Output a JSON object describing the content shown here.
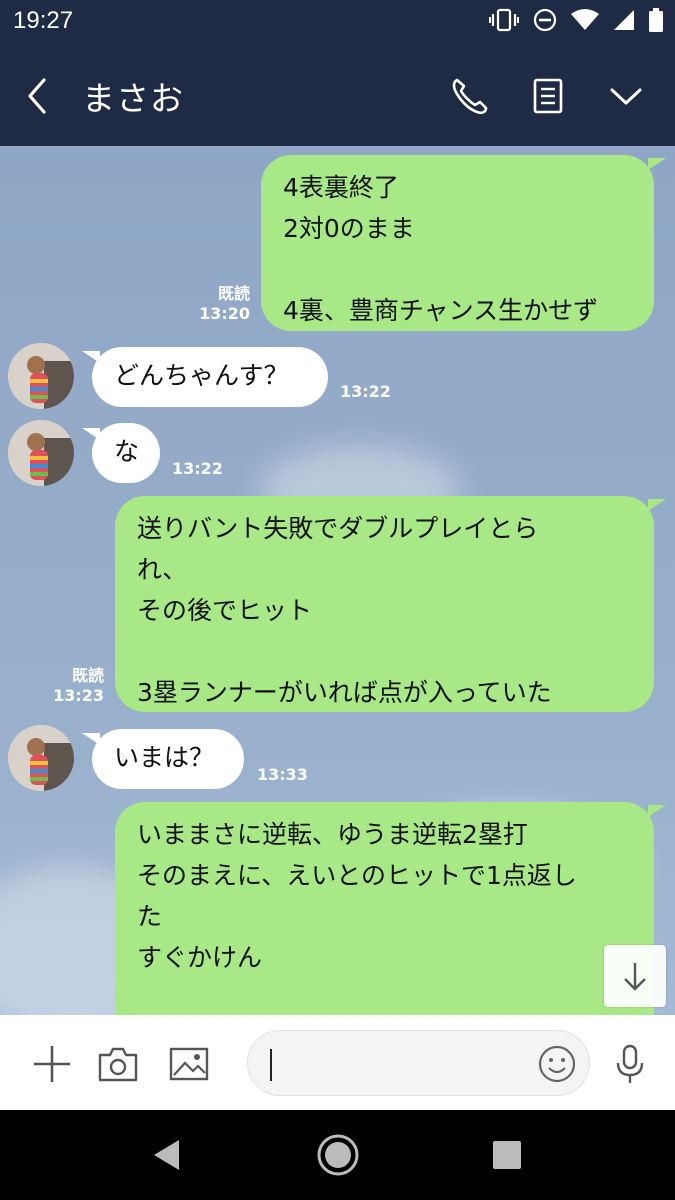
{
  "status_bar": {
    "time": "19:27"
  },
  "header": {
    "title": "まさお"
  },
  "messages": [
    {
      "from": "me",
      "text": "4表裏終了\n2対0のまま\n\n4裏、豊商チャンス生かせず",
      "read": "既読",
      "time": "13:20"
    },
    {
      "from": "them",
      "text": "どんちゃんす？",
      "time": "13:22"
    },
    {
      "from": "them",
      "text": "な",
      "time": "13:22"
    },
    {
      "from": "me",
      "text": "送りバント失敗でダブルプレイとら\nれ、\nその後でヒット\n\n3塁ランナーがいれば点が入っていた",
      "read": "既読",
      "time": "13:23"
    },
    {
      "from": "them",
      "text": "いまは？",
      "time": "13:33"
    },
    {
      "from": "me",
      "text": "いままさに逆転、ゆうま逆転2塁打\nそのまえに、えいとのヒットで1点返し\nた\nすぐかけん\n"
    }
  ],
  "input": {
    "placeholder": ""
  },
  "icons": {
    "back": "chevron-left-icon",
    "call": "phone-icon",
    "notes": "notes-icon",
    "menu": "chevron-down-icon",
    "add": "plus-icon",
    "camera": "camera-icon",
    "image": "image-icon",
    "emoji": "emoji-icon",
    "mic": "mic-icon",
    "scroll": "arrow-down-icon"
  },
  "colors": {
    "header": "#1f2a44",
    "outgoing_bubble": "#a9e886",
    "incoming_bubble": "#ffffff"
  }
}
